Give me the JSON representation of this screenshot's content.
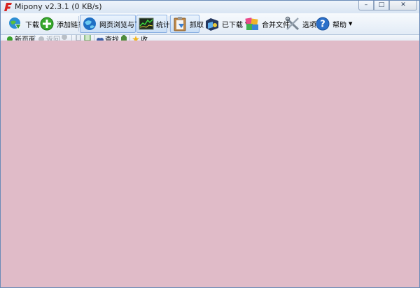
{
  "window": {
    "title": "Mipony v2.3.1 (0 KB/s)",
    "controls": {
      "minimize": "–",
      "maximize": "□",
      "close": "✕"
    }
  },
  "toolbar": {
    "download_label": "下载",
    "add_link_label": "添加链接",
    "browse_download_label": "网页浏览与下载",
    "stats_label": "统计",
    "grab_label": "抓取",
    "downloaded_label": "已下载",
    "merge_files_label": "合并文件",
    "options_label": "选项",
    "help_label": "帮助"
  },
  "navbar": {
    "new_page_label": "新页面",
    "back_label": "返回",
    "search_label": "查找",
    "favorites_label": "收"
  },
  "colors": {
    "content_background": "#e0bbc8",
    "chrome_blue": "#dfe8f5"
  }
}
